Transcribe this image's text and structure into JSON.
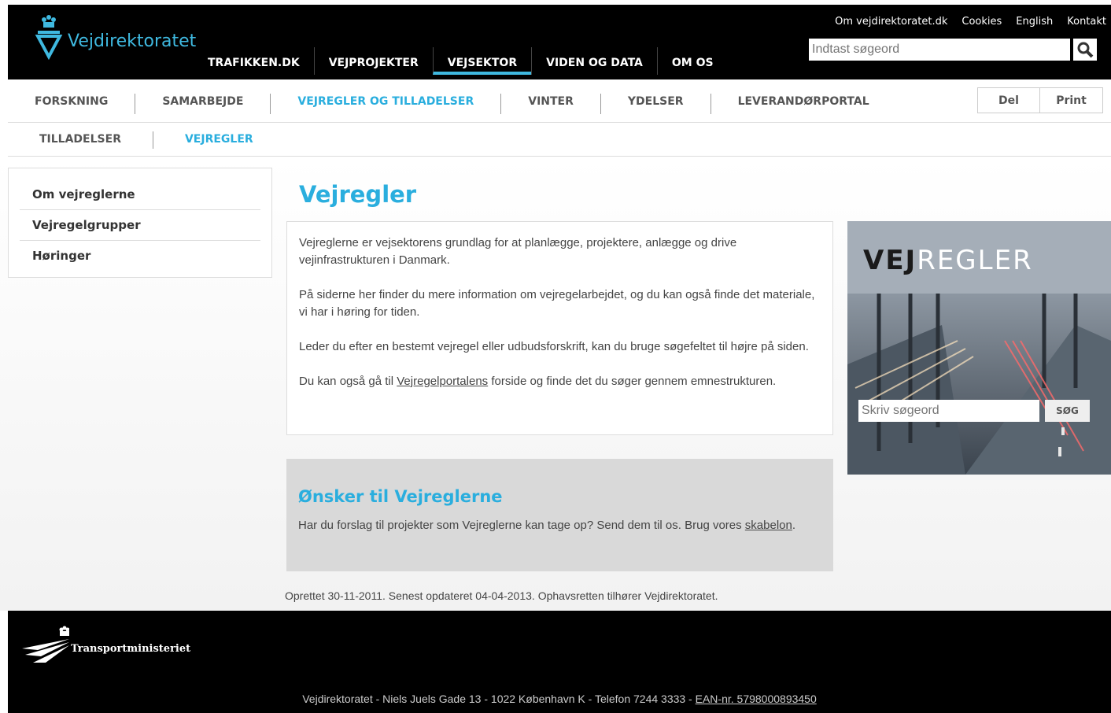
{
  "brand": {
    "name": "Vejdirektoratet"
  },
  "top_links": [
    "Om vejdirektoratet.dk",
    "Cookies",
    "English",
    "Kontakt"
  ],
  "search": {
    "placeholder": "Indtast søgeord"
  },
  "main_nav": [
    {
      "label": "TRAFIKKEN.DK",
      "active": false
    },
    {
      "label": "VEJPROJEKTER",
      "active": false
    },
    {
      "label": "VEJSEKTOR",
      "active": true
    },
    {
      "label": "VIDEN OG DATA",
      "active": false
    },
    {
      "label": "OM OS",
      "active": false
    }
  ],
  "sub_nav": [
    {
      "label": "FORSKNING",
      "active": false
    },
    {
      "label": "SAMARBEJDE",
      "active": false
    },
    {
      "label": "VEJREGLER OG TILLADELSER",
      "active": true
    },
    {
      "label": "VINTER",
      "active": false
    },
    {
      "label": "YDELSER",
      "active": false
    },
    {
      "label": "LEVERANDØRPORTAL",
      "active": false
    }
  ],
  "share": {
    "share_label": "Del",
    "print_label": "Print"
  },
  "sub_nav2": [
    {
      "label": "TILLADELSER",
      "active": false
    },
    {
      "label": "VEJREGLER",
      "active": true
    }
  ],
  "left_menu": [
    "Om vejreglerne",
    "Vejregelgrupper",
    "Høringer"
  ],
  "page": {
    "title": "Vejregler",
    "p1": "Vejreglerne er vejsektorens grundlag for at planlægge, projektere, anlægge og drive vejinfrastrukturen i Danmark.",
    "p2": "På siderne her finder du mere information om vejregelarbejdet, og du kan også finde det materiale, vi har i høring for tiden.",
    "p3": "Leder du efter en bestemt vejregel eller udbudsforskrift, kan du bruge søgefeltet til højre på siden.",
    "p4_pre": "Du kan også gå til ",
    "p4_link": "Vejregelportalens",
    "p4_post": " forside og finde det du søger gennem emnestrukturen."
  },
  "wish": {
    "title": "Ønsker til Vejreglerne",
    "text_pre": "Har du forslag til projekter som Vejreglerne kan tage op? Send dem til os. Brug vores ",
    "link": "skabelon",
    "text_post": "."
  },
  "meta": "Oprettet 30-11-2011. Senest opdateret 04-04-2013. Ophavsretten tilhører Vejdirektoratet.",
  "promo": {
    "title_bold": "VEJ",
    "title_light": "REGLER",
    "input_placeholder": "Skriv søgeord",
    "button_label": "SØG"
  },
  "footer": {
    "ministry": "Transportministeriet",
    "address": "Vejdirektoratet - Niels Juels Gade 13 - 1022 København K - Telefon 7244 3333 - ",
    "ean": "EAN-nr. 5798000893450"
  },
  "colors": {
    "accent": "#2aaede",
    "header_bg": "#000000",
    "panel_bg": "#d9d9d9"
  }
}
